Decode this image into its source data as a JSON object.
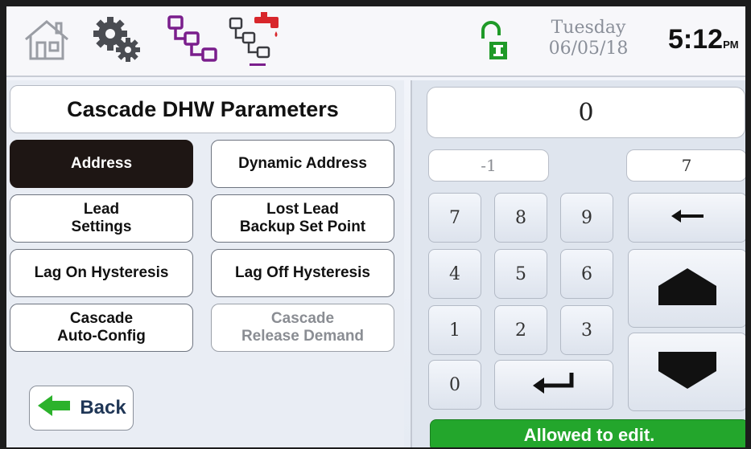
{
  "topbar": {
    "icons": [
      "home-icon",
      "settings-gears-icon",
      "cascade-icon",
      "cascade-dhw-icon"
    ],
    "lock_icon": "lock-open-icon",
    "day": "Tuesday",
    "date": "06/05/18",
    "time": "5:12",
    "ampm": "PM"
  },
  "page": {
    "title": "Cascade DHW Parameters"
  },
  "params": [
    {
      "label": "Address",
      "state": "active"
    },
    {
      "label": "Dynamic Address",
      "state": "normal"
    },
    {
      "label": "Lead\nSettings",
      "state": "normal"
    },
    {
      "label": "Lost Lead\nBackup Set Point",
      "state": "normal"
    },
    {
      "label": "Lag On Hysteresis",
      "state": "normal"
    },
    {
      "label": "Lag Off Hysteresis",
      "state": "normal"
    },
    {
      "label": "Cascade\nAuto-Config",
      "state": "normal"
    },
    {
      "label": "Cascade\nRelease Demand",
      "state": "disabled"
    }
  ],
  "back": {
    "label": "Back",
    "icon": "arrow-left-icon"
  },
  "keypad": {
    "display_value": "0",
    "min": "-1",
    "max": "7",
    "keys": [
      "7",
      "8",
      "9",
      "4",
      "5",
      "6",
      "1",
      "2",
      "3",
      "0"
    ],
    "backspace_icon": "backspace-arrow-icon",
    "enter_icon": "enter-icon",
    "up_icon": "arrow-up-icon",
    "down_icon": "arrow-down-icon",
    "status": "Allowed to edit."
  },
  "colors": {
    "active": "#1e1614",
    "status_ok": "#23a62c",
    "back_arrow": "#2bb22b",
    "cascade_icon": "#7a1e8c",
    "water_red": "#d8262b"
  }
}
